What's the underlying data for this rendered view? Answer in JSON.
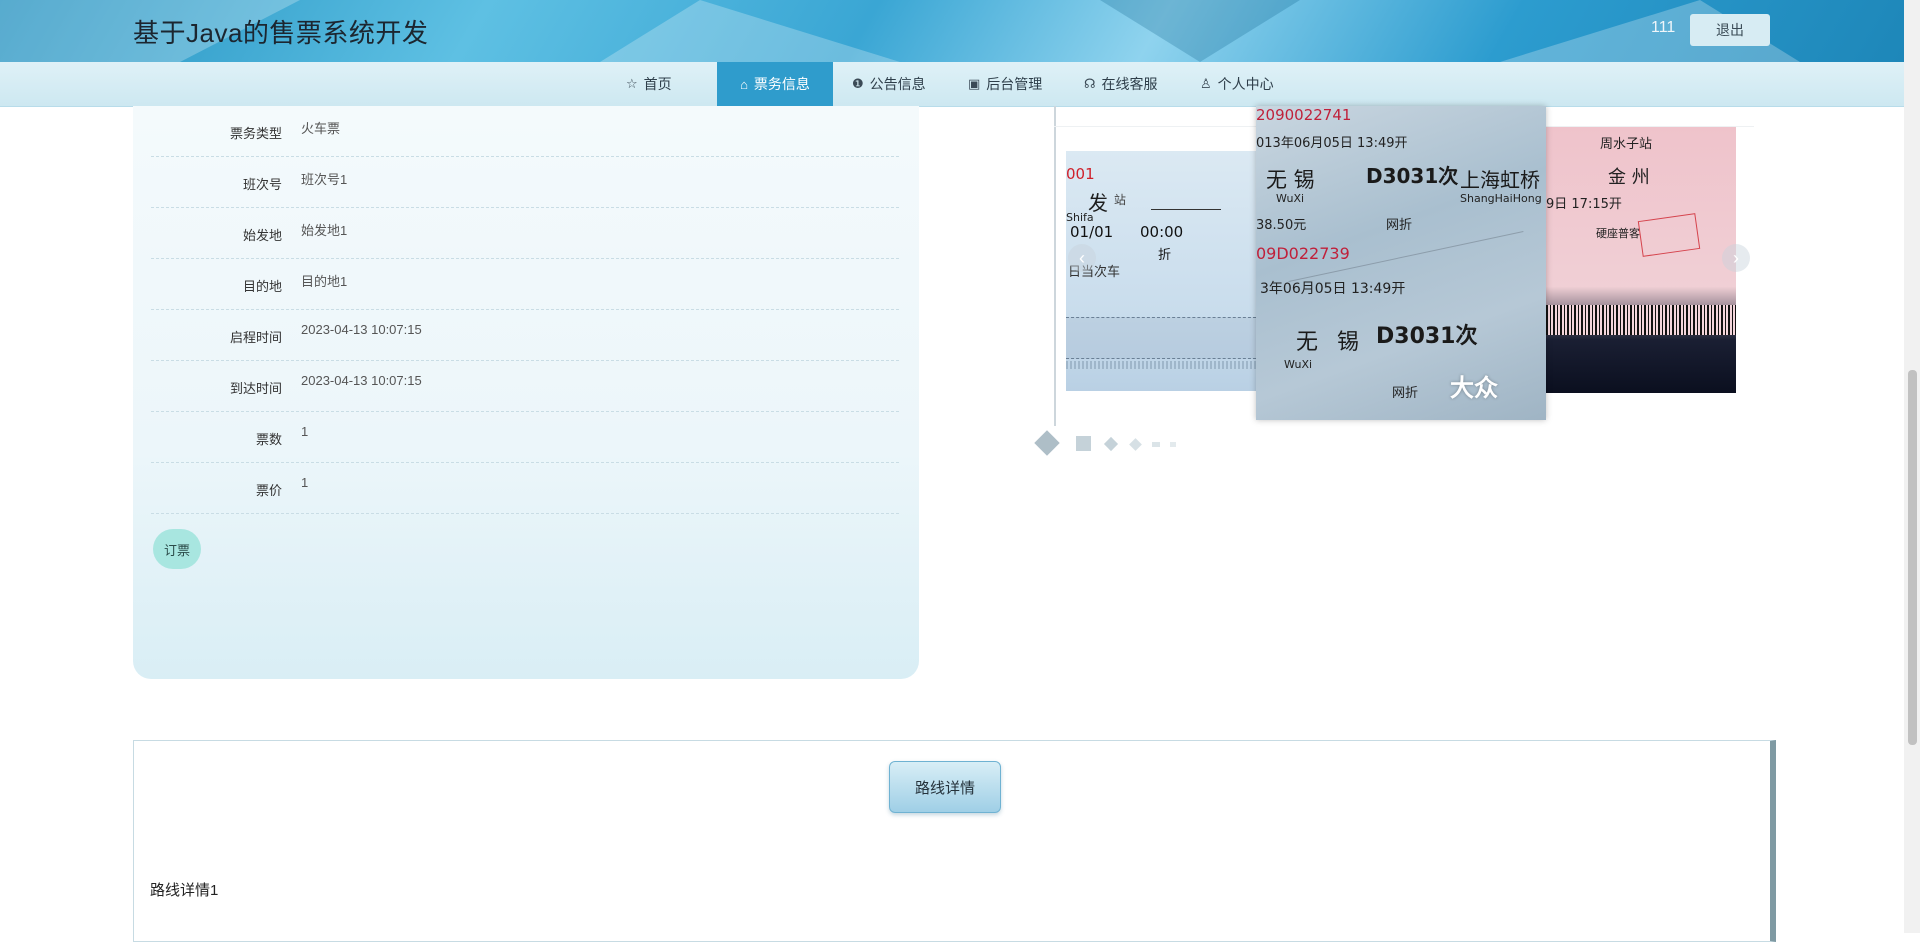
{
  "header": {
    "site_title": "基于Java的售票系统开发",
    "username": "111",
    "logout_label": "退出"
  },
  "nav": {
    "items": [
      {
        "label": "首页",
        "icon": "star-icon"
      },
      {
        "label": "票务信息",
        "icon": "bag-icon",
        "active": true
      },
      {
        "label": "公告信息",
        "icon": "alert-circle-icon"
      },
      {
        "label": "后台管理",
        "icon": "briefcase-icon"
      },
      {
        "label": "在线客服",
        "icon": "headset-icon"
      },
      {
        "label": "个人中心",
        "icon": "user-icon"
      }
    ]
  },
  "details": {
    "rows": [
      {
        "label": "票务类型",
        "value": "火车票"
      },
      {
        "label": "班次号",
        "value": "班次号1"
      },
      {
        "label": "始发地",
        "value": "始发地1"
      },
      {
        "label": "目的地",
        "value": "目的地1"
      },
      {
        "label": "启程时间",
        "value": "2023-04-13 10:07:15"
      },
      {
        "label": "到达时间",
        "value": "2023-04-13 10:07:15"
      },
      {
        "label": "票数",
        "value": "1"
      },
      {
        "label": "票价",
        "value": "1"
      }
    ],
    "order_button": "订票"
  },
  "carousel": {
    "left_ticket": {
      "code": "001",
      "from": "发",
      "station": "站",
      "pinyin": "Shifa",
      "date": "01/01",
      "time": "00:00",
      "note": "折",
      "note2": "日当次车"
    },
    "center_ticket": {
      "code_top": "2090022741",
      "date_top": "013年06月05日 13:49开",
      "from": "无 锡",
      "train": "D3031次",
      "to": "上海虹桥",
      "from_pinyin": "WuXi",
      "to_pinyin": "ShangHaiHong",
      "price": "38.50元",
      "tag": "网折",
      "code_bottom": "09D022739",
      "date_bottom": "3年06月05日 13:49开",
      "watermark": "大众"
    },
    "right_ticket": {
      "station": "周水子站",
      "to": "金 州",
      "time": "9日 17:15开",
      "seat": "硬座普客"
    },
    "active_index": 0
  },
  "route": {
    "heading": "路线详情",
    "text": "路线详情1"
  }
}
